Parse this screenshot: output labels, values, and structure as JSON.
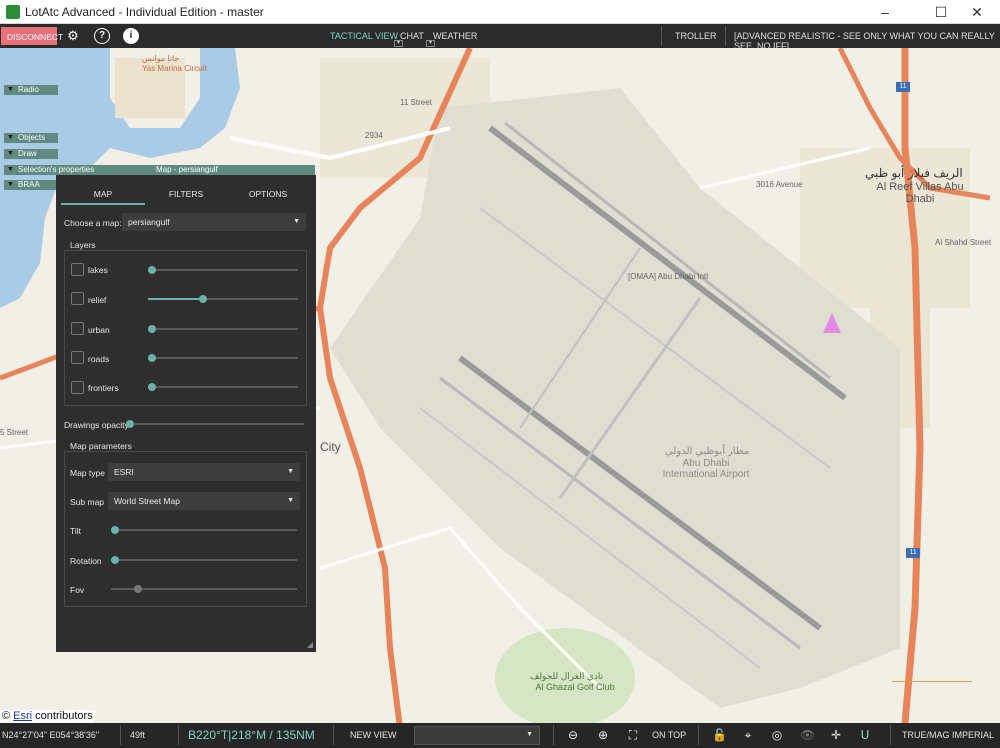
{
  "window": {
    "title": "LotAtc Advanced - Individual Edition - master"
  },
  "toolbar": {
    "disconnect_label": "DISCONNECT",
    "icons": [
      "gear-icon",
      "help-icon",
      "info-icon"
    ],
    "tabs": [
      {
        "label": "TACTICAL VIEW",
        "active": true
      },
      {
        "label": "CHAT",
        "active": false
      },
      {
        "label": "WEATHER",
        "active": false
      }
    ],
    "troller_label": "TROLLER",
    "mode_text": "[ADVANCED REALISTIC - SEE ONLY WHAT YOU CAN REALLY SEE, NO IFF]"
  },
  "side_sections": [
    "Radio",
    "Objects",
    "Draw",
    "Selection's properties",
    "BRAA"
  ],
  "panel": {
    "title": "Map - persiangulf",
    "tabs": [
      "MAP",
      "FILTERS",
      "OPTIONS"
    ],
    "choose_map_label": "Choose a map:",
    "choose_map_value": "persiangulf",
    "layers_title": "Layers",
    "layers": [
      {
        "label": "lakes",
        "value": 0.0
      },
      {
        "label": "relief",
        "value": 0.36
      },
      {
        "label": "urban",
        "value": 0.0
      },
      {
        "label": "roads",
        "value": 0.0
      },
      {
        "label": "frontiers",
        "value": 0.0
      }
    ],
    "drawings_opacity_label": "Drawings opacity",
    "drawings_opacity_value": 0.0,
    "map_params_title": "Map parameters",
    "map_type_label": "Map type",
    "map_type_value": "ESRI",
    "sub_map_label": "Sub map",
    "sub_map_value": "World Street Map",
    "tilt_label": "Tilt",
    "tilt_value": 0.0,
    "rotation_label": "Rotation",
    "rotation_value": 0.0,
    "fov_label": "Fov",
    "fov_value": 0.13
  },
  "map": {
    "labels": {
      "airport_en": "Abu Dhabi International Airport",
      "airport_ar": "مطار أبوظبي الدولي",
      "omaa": "[OMAA] Abu Dhabi Intl",
      "reef_ar": "الريف فيلاز أبو ظبي",
      "reef_en": "Al Reef Villas Abu Dhabi",
      "golf_ar": "نادي الغزال للجولف",
      "golf_en": "Al Ghazal Golf Club",
      "city": "City",
      "yas_ar": "جاتا موانس",
      "yas_en": "Yas Marina Circuit",
      "street_2934": "2934",
      "street_3016": "3016 Avenue",
      "street_11": "11 Street",
      "street_5": "5 Street",
      "hwy_11a": "11",
      "hwy_11b": "11",
      "al_shahd": "Al Shahd Street"
    },
    "attribution": {
      "prefix": "© ",
      "link": "Esri",
      "suffix": " contributors"
    }
  },
  "statusbar": {
    "coords": "N24°27'04\" E054°38'36\"",
    "altitude": "49ft",
    "bearing": "B220°T|218°M / 135NM",
    "new_view": "NEW VIEW",
    "on_top": "ON TOP",
    "true_mag": "TRUE/MAG",
    "imperial": "IMPERIAL"
  },
  "colors": {
    "accent": "#6bb3a8",
    "disconnect": "#e8707a",
    "map_bg": "#f2efe6",
    "highway": "#e8845a",
    "water": "#aacbe6",
    "aircraft": "#e48ae6"
  }
}
